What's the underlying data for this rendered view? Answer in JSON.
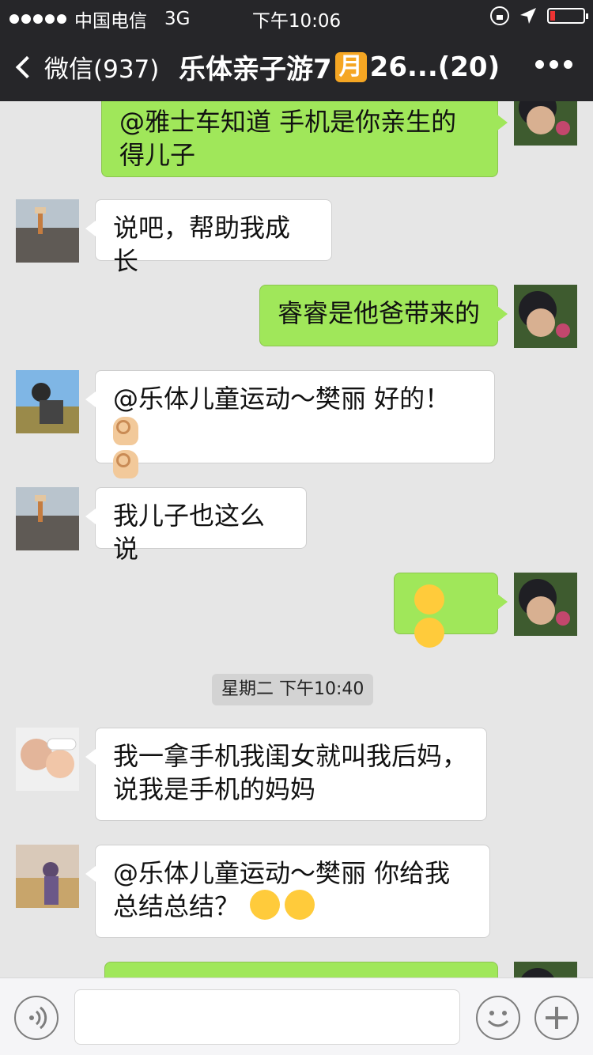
{
  "status_bar": {
    "carrier": "中国电信",
    "network": "3G",
    "time": "下午10:06"
  },
  "nav": {
    "back_label": "微信(937)",
    "title_before": "乐体亲子游7",
    "title_badge": "月",
    "title_after": "26...(20)"
  },
  "messages": [
    {
      "side": "out",
      "text": "@雅士车知道 手机是你亲生的得儿子"
    },
    {
      "side": "in",
      "text": "说吧，帮助我成长"
    },
    {
      "side": "out",
      "text": "睿睿是他爸带来的"
    },
    {
      "side": "in",
      "text": "@乐体儿童运动～樊丽 好的！"
    },
    {
      "side": "in",
      "text": "我儿子也这么说"
    },
    {
      "side": "out",
      "text": ""
    },
    {
      "side": "in",
      "text": "我一拿手机我闺女就叫我后妈，说我是手机的妈妈"
    },
    {
      "side": "in",
      "text": "@乐体儿童运动～樊丽 你给我总结总结？"
    }
  ],
  "timestamp": "星期二 下午10:40",
  "colors": {
    "topbar": "#262629",
    "chat_background": "#e6e6e6",
    "outgoing_bubble": "#a0e75a",
    "incoming_bubble": "#ffffff",
    "battery_low": "#ee3333"
  },
  "icons": [
    "back-icon",
    "lock-icon",
    "location-arrow-icon",
    "battery-icon",
    "more-icon",
    "voice-icon",
    "emoji-face-icon",
    "plus-icon"
  ]
}
